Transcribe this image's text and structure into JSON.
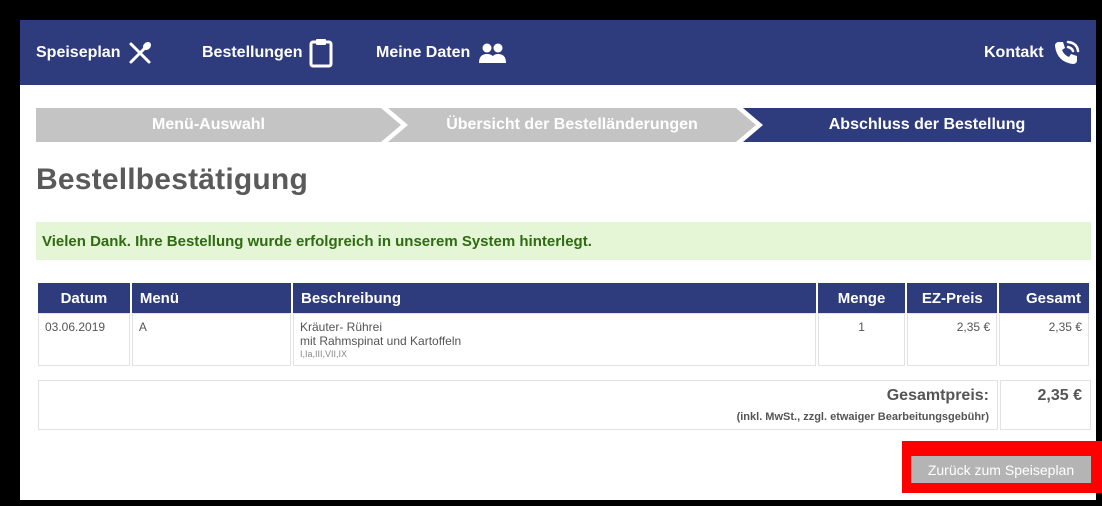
{
  "nav": {
    "items": [
      {
        "label": "Speiseplan",
        "icon": "cutlery-icon"
      },
      {
        "label": "Bestellungen",
        "icon": "clipboard-icon"
      },
      {
        "label": "Meine Daten",
        "icon": "users-icon"
      }
    ],
    "contact": {
      "label": "Kontakt",
      "icon": "phone-icon"
    }
  },
  "steps": [
    {
      "label": "Menü-Auswahl",
      "state": "done"
    },
    {
      "label": "Übersicht der Bestelländerungen",
      "state": "done"
    },
    {
      "label": "Abschluss der Bestellung",
      "state": "active"
    }
  ],
  "page_title": "Bestellbestätigung",
  "success_message": "Vielen Dank. Ihre Bestellung wurde erfolgreich in unserem System hinterlegt.",
  "table": {
    "headers": [
      "Datum",
      "Menü",
      "Beschreibung",
      "Menge",
      "EZ-Preis",
      "Gesamt"
    ],
    "rows": [
      {
        "date": "03.06.2019",
        "menu": "A",
        "description_line1": "Kräuter- Rührei",
        "description_line2": "mit Rahmspinat und Kartoffeln",
        "allergens": "I,Ia,III,VII,IX",
        "quantity": "1",
        "unit_price": "2,35 €",
        "total": "2,35 €"
      }
    ]
  },
  "summary": {
    "label": "Gesamtpreis:",
    "note": "(inkl. MwSt., zzgl. etwaiger Bearbeitungsgebühr)",
    "value": "2,35 €"
  },
  "back_button": "Zurück zum Speiseplan",
  "colors": {
    "primary": "#2e3c7e",
    "step_done": "#c4c4c4",
    "success_bg": "#e4f6d6",
    "success_text": "#2f6b13",
    "highlight": "#ff0000"
  }
}
